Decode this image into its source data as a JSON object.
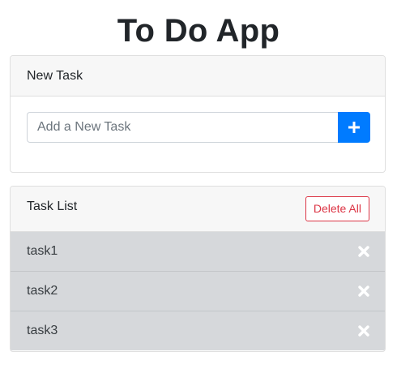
{
  "app": {
    "title": "To Do App"
  },
  "new_task": {
    "header": "New Task",
    "input_placeholder": "Add a New Task",
    "input_value": "",
    "add_icon": "plus-icon"
  },
  "task_list": {
    "header": "Task List",
    "delete_all_label": "Delete All",
    "items": [
      {
        "label": "task1",
        "remove_icon": "close-icon"
      },
      {
        "label": "task2",
        "remove_icon": "close-icon"
      },
      {
        "label": "task3",
        "remove_icon": "close-icon"
      }
    ]
  },
  "colors": {
    "primary": "#007bff",
    "danger": "#dc3545",
    "task_background": "#d6d8db"
  }
}
